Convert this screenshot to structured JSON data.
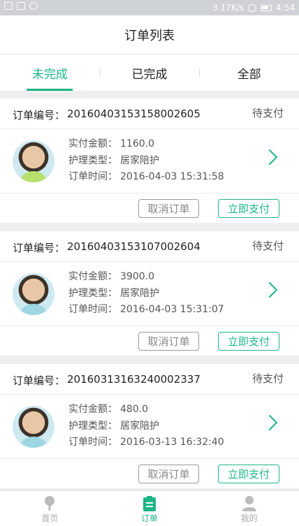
{
  "status_bar": {
    "speed": "3.17K/s",
    "time": "4:54"
  },
  "header": {
    "title": "订单列表"
  },
  "tabs": [
    {
      "label": "未完成",
      "active": true
    },
    {
      "label": "已完成",
      "active": false
    },
    {
      "label": "全部",
      "active": false
    }
  ],
  "labels": {
    "order_no": "订单编号：",
    "amount": "实付金额：",
    "care_type": "护理类型：",
    "order_time": "订单时间：",
    "cancel": "取消订单",
    "pay": "立即支付"
  },
  "orders": [
    {
      "order_no": "20160403153158002605",
      "status": "待支付",
      "amount": "1160.0",
      "care_type": "居家陪护",
      "order_time": "2016-04-03 15:31:58"
    },
    {
      "order_no": "20160403153107002604",
      "status": "待支付",
      "amount": "3900.0",
      "care_type": "居家陪护",
      "order_time": "2016-04-03 15:31:07"
    },
    {
      "order_no": "20160313163240002337",
      "status": "待支付",
      "amount": "480.0",
      "care_type": "居家陪护",
      "order_time": "2016-03-13 16:32:40"
    }
  ],
  "bottom_nav": [
    {
      "label": "首页",
      "icon": "tree-icon",
      "active": false
    },
    {
      "label": "订单",
      "icon": "clipboard-icon",
      "active": true
    },
    {
      "label": "我的",
      "icon": "user-icon",
      "active": false
    }
  ],
  "colors": {
    "accent": "#1db58a"
  }
}
